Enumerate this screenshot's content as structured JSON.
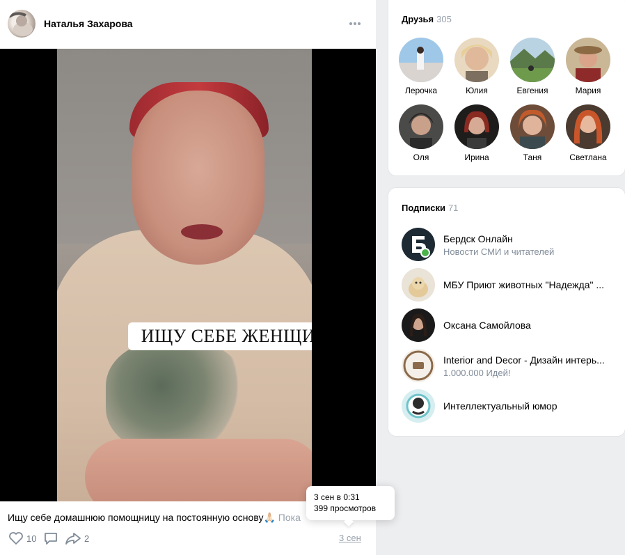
{
  "post": {
    "author": "Наталья Захарова",
    "more_icon": "ellipsis-icon",
    "video_caption": "ИЩУ СЕБЕ ЖЕНЩИНУ",
    "text": "Ищу себе домашнюю помощницу на постоянную основу",
    "text_emoji": "🙏🏻",
    "text_more": "Пока",
    "likes": "10",
    "shares": "2",
    "date_link": "3 сен",
    "tooltip": {
      "datetime": "3 сен в 0:31",
      "views": "399 просмотров"
    }
  },
  "friends": {
    "title": "Друзья",
    "count": "305",
    "items": [
      {
        "name": "Лерочка"
      },
      {
        "name": "Юлия"
      },
      {
        "name": "Евгения"
      },
      {
        "name": "Мария"
      },
      {
        "name": "Оля"
      },
      {
        "name": "Ирина"
      },
      {
        "name": "Таня"
      },
      {
        "name": "Светлана"
      }
    ]
  },
  "subscriptions": {
    "title": "Подписки",
    "count": "71",
    "items": [
      {
        "name": "Бердск Онлайн",
        "desc": "Новости СМИ и читателей"
      },
      {
        "name": "МБУ Приют животных \"Надежда\" ...",
        "desc": ""
      },
      {
        "name": "Оксана Самойлова",
        "desc": ""
      },
      {
        "name": "Interior and Decor - Дизайн интерь...",
        "desc": "1.000.000 Идей!"
      },
      {
        "name": "Интеллектуальный юмор",
        "desc": ""
      }
    ]
  },
  "colors": {
    "page_bg": "#edeef0",
    "muted_text": "#99a2ad",
    "online_dot": "#4bb34b"
  }
}
